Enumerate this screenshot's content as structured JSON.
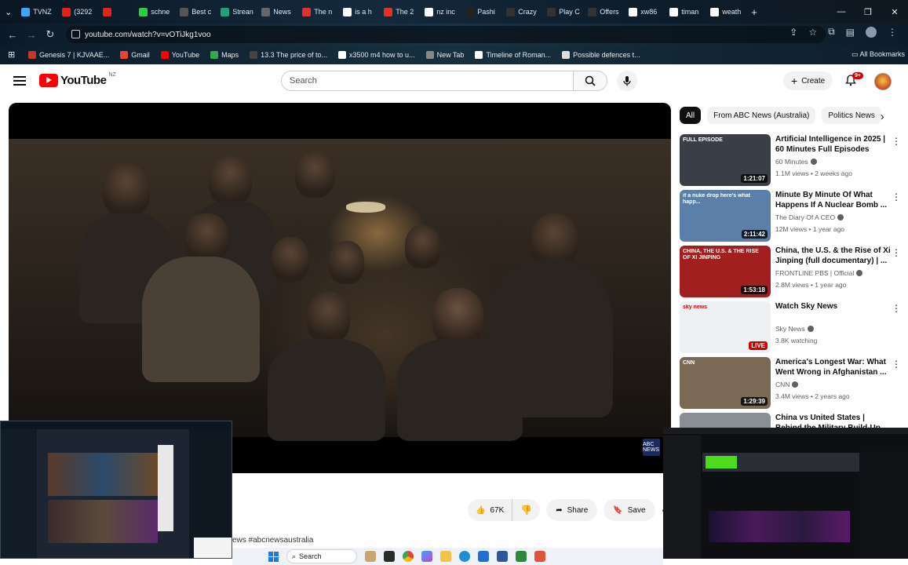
{
  "browser": {
    "tabs": [
      {
        "label": "TVNZ",
        "color": "#3aa7ff"
      },
      {
        "label": "(3292",
        "color": "#e62117"
      },
      {
        "label": "",
        "color": "#e62117"
      },
      {
        "label": "schne",
        "color": "#2ecc40"
      },
      {
        "label": "Best c",
        "color": "#555555"
      },
      {
        "label": "Strean",
        "color": "#1fa37a"
      },
      {
        "label": "News",
        "color": "#666666"
      },
      {
        "label": "The n",
        "color": "#e0312e"
      },
      {
        "label": "is a h",
        "color": "#ffffff"
      },
      {
        "label": "The 2",
        "color": "#e0312e"
      },
      {
        "label": "nz inc",
        "color": "#ffffff"
      },
      {
        "label": "Pashi",
        "color": "#222222"
      },
      {
        "label": "Crazy",
        "color": "#333333"
      },
      {
        "label": "Play C",
        "color": "#333333"
      },
      {
        "label": "Offers",
        "color": "#333333"
      },
      {
        "label": "xw86",
        "color": "#ffffff"
      },
      {
        "label": "timan",
        "color": "#ffffff"
      },
      {
        "label": "weath",
        "color": "#ffffff"
      }
    ],
    "new_tab": "+",
    "window_controls": {
      "minimize": "—",
      "maximize": "❐",
      "close": "✕"
    },
    "url": "youtube.com/watch?v=vOTiJkg1voo",
    "bookmarks": [
      {
        "label": "Genesis 7 | KJVAAE...",
        "color": "#c0392b"
      },
      {
        "label": "Gmail",
        "color": "#ea4335"
      },
      {
        "label": "YouTube",
        "color": "#ff0000"
      },
      {
        "label": "Maps",
        "color": "#34a853"
      },
      {
        "label": "13.3 The price of to...",
        "color": "#444444"
      },
      {
        "label": "x3500 m4 how to u...",
        "color": "#ffffff"
      },
      {
        "label": "New Tab",
        "color": "#888888"
      },
      {
        "label": "Timeline of Roman...",
        "color": "#ffffff"
      },
      {
        "label": "Possible defences t...",
        "color": "#dddddd"
      }
    ],
    "all_bookmarks": "All Bookmarks"
  },
  "youtube": {
    "brand": "YouTube",
    "country": "NZ",
    "search_placeholder": "Search",
    "create_label": "Create",
    "notif_count": "9+",
    "actions": {
      "likes": "67K",
      "share": "Share",
      "save": "Save",
      "more": "⋯"
    },
    "tagline": "ews #abcnewsaustralia",
    "watermark": "ABC NEWS",
    "chips": [
      "All",
      "From ABC News (Australia)",
      "Politics News"
    ],
    "recommended": [
      {
        "title": "Artificial Intelligence in 2025 | 60 Minutes Full Episodes",
        "channel": "60 Minutes",
        "verified": true,
        "meta": "1.1M views • 2 weeks ago",
        "duration": "1:21:07",
        "thumb_color": "#3a3f47",
        "thumb_label": "FULL EPISODE"
      },
      {
        "title": "Minute By Minute Of What Happens If A Nuclear Bomb ...",
        "channel": "The Diary Of A CEO",
        "verified": true,
        "meta": "12M views • 1 year ago",
        "duration": "2:11:42",
        "thumb_color": "#5b7fa8",
        "thumb_label": "if a nuke drop here's what happ..."
      },
      {
        "title": "China, the U.S. & the Rise of Xi Jinping (full documentary) | ...",
        "channel": "FRONTLINE PBS | Official",
        "verified": true,
        "meta": "2.8M views • 1 year ago",
        "duration": "1:53:18",
        "thumb_color": "#a11f1f",
        "thumb_label": "CHINA, THE U.S. & THE RISE OF XI JINPING"
      },
      {
        "title": "Watch Sky News",
        "channel": "Sky News",
        "verified": true,
        "meta": "3.8K watching",
        "duration": "LIVE",
        "thumb_color": "#eef0f3",
        "thumb_label": "sky news"
      },
      {
        "title": "America's Longest War: What Went Wrong in Afghanistan ...",
        "channel": "CNN",
        "verified": true,
        "meta": "3.4M views • 2 years ago",
        "duration": "1:29:39",
        "thumb_color": "#7a6a55",
        "thumb_label": "CNN"
      },
      {
        "title": "China vs United States | Behind the Military Build-Up",
        "channel": "",
        "verified": false,
        "meta": "",
        "duration": "",
        "thumb_color": "#8a8f96",
        "thumb_label": ""
      }
    ]
  },
  "taskbar": {
    "search": "Search"
  }
}
